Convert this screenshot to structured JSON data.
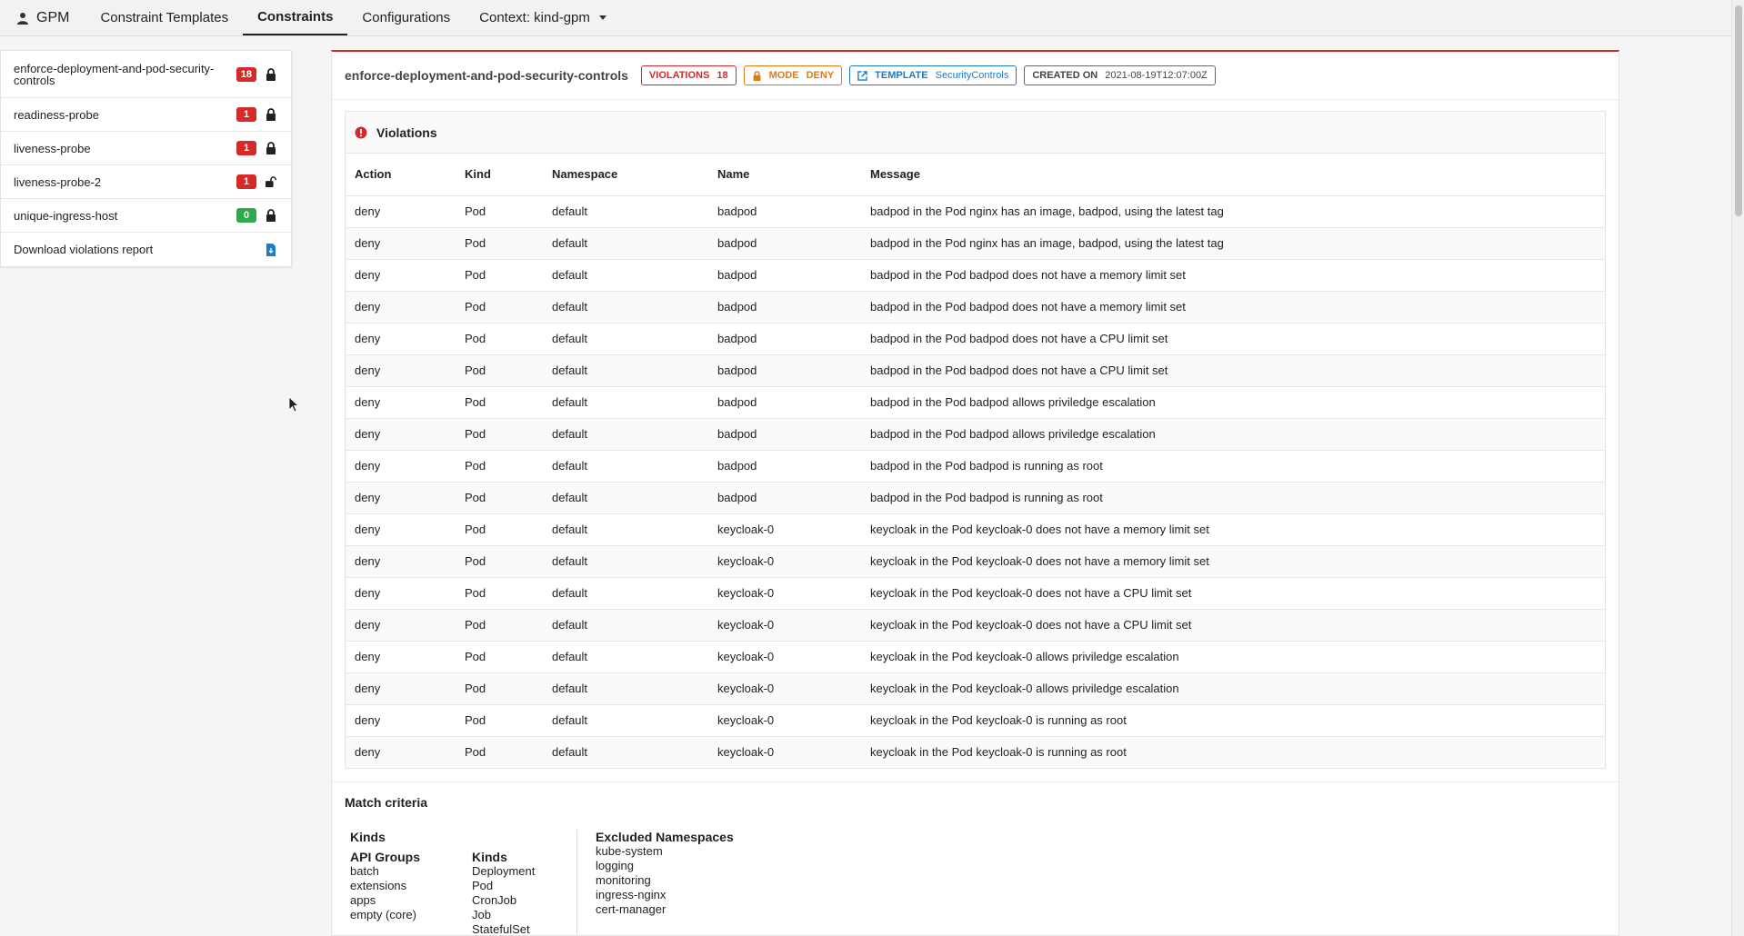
{
  "nav": {
    "brand": "GPM",
    "items": [
      {
        "label": "Constraint Templates",
        "active": false
      },
      {
        "label": "Constraints",
        "active": true
      },
      {
        "label": "Configurations",
        "active": false
      },
      {
        "label": "Context: kind-gpm",
        "active": false
      }
    ]
  },
  "sidebar": {
    "items": [
      {
        "label": "enforce-deployment-and-pod-security-controls",
        "count": "18",
        "count_color": "red",
        "lock": "locked"
      },
      {
        "label": "readiness-probe",
        "count": "1",
        "count_color": "red",
        "lock": "locked"
      },
      {
        "label": "liveness-probe",
        "count": "1",
        "count_color": "red",
        "lock": "locked"
      },
      {
        "label": "liveness-probe-2",
        "count": "1",
        "count_color": "red",
        "lock": "unlocked"
      },
      {
        "label": "unique-ingress-host",
        "count": "0",
        "count_color": "green",
        "lock": "locked"
      }
    ],
    "download_label": "Download violations report"
  },
  "constraint": {
    "title": "enforce-deployment-and-pod-security-controls",
    "violations_label": "VIOLATIONS",
    "violations_value": "18",
    "mode_label": "MODE",
    "mode_value": "DENY",
    "template_label": "TEMPLATE",
    "template_value": "SecurityControls",
    "created_label": "CREATED ON",
    "created_value": "2021-08-19T12:07:00Z"
  },
  "violations": {
    "title": "Violations",
    "columns": [
      "Action",
      "Kind",
      "Namespace",
      "Name",
      "Message"
    ],
    "rows": [
      [
        "deny",
        "Pod",
        "default",
        "badpod",
        "badpod in the Pod nginx has an image, badpod, using the latest tag"
      ],
      [
        "deny",
        "Pod",
        "default",
        "badpod",
        "badpod in the Pod nginx has an image, badpod, using the latest tag"
      ],
      [
        "deny",
        "Pod",
        "default",
        "badpod",
        "badpod in the Pod badpod does not have a memory limit set"
      ],
      [
        "deny",
        "Pod",
        "default",
        "badpod",
        "badpod in the Pod badpod does not have a memory limit set"
      ],
      [
        "deny",
        "Pod",
        "default",
        "badpod",
        "badpod in the Pod badpod does not have a CPU limit set"
      ],
      [
        "deny",
        "Pod",
        "default",
        "badpod",
        "badpod in the Pod badpod does not have a CPU limit set"
      ],
      [
        "deny",
        "Pod",
        "default",
        "badpod",
        "badpod in the Pod badpod allows priviledge escalation"
      ],
      [
        "deny",
        "Pod",
        "default",
        "badpod",
        "badpod in the Pod badpod allows priviledge escalation"
      ],
      [
        "deny",
        "Pod",
        "default",
        "badpod",
        "badpod in the Pod badpod is running as root"
      ],
      [
        "deny",
        "Pod",
        "default",
        "badpod",
        "badpod in the Pod badpod is running as root"
      ],
      [
        "deny",
        "Pod",
        "default",
        "keycloak-0",
        "keycloak in the Pod keycloak-0 does not have a memory limit set"
      ],
      [
        "deny",
        "Pod",
        "default",
        "keycloak-0",
        "keycloak in the Pod keycloak-0 does not have a memory limit set"
      ],
      [
        "deny",
        "Pod",
        "default",
        "keycloak-0",
        "keycloak in the Pod keycloak-0 does not have a CPU limit set"
      ],
      [
        "deny",
        "Pod",
        "default",
        "keycloak-0",
        "keycloak in the Pod keycloak-0 does not have a CPU limit set"
      ],
      [
        "deny",
        "Pod",
        "default",
        "keycloak-0",
        "keycloak in the Pod keycloak-0 allows priviledge escalation"
      ],
      [
        "deny",
        "Pod",
        "default",
        "keycloak-0",
        "keycloak in the Pod keycloak-0 allows priviledge escalation"
      ],
      [
        "deny",
        "Pod",
        "default",
        "keycloak-0",
        "keycloak in the Pod keycloak-0 is running as root"
      ],
      [
        "deny",
        "Pod",
        "default",
        "keycloak-0",
        "keycloak in the Pod keycloak-0 is running as root"
      ]
    ]
  },
  "match": {
    "title": "Match criteria",
    "kinds_heading": "Kinds",
    "api_groups_heading": "API Groups",
    "api_groups": [
      "batch",
      "extensions",
      "apps",
      "empty (core)"
    ],
    "kinds_sub_heading": "Kinds",
    "kinds": [
      "Deployment",
      "Pod",
      "CronJob",
      "Job",
      "StatefulSet"
    ],
    "excluded_heading": "Excluded Namespaces",
    "excluded": [
      "kube-system",
      "logging",
      "monitoring",
      "ingress-nginx",
      "cert-manager"
    ]
  },
  "colors": {
    "danger": "#d42a2a",
    "success": "#2fa84f",
    "warning": "#e07b10",
    "info": "#1f7ac7"
  }
}
